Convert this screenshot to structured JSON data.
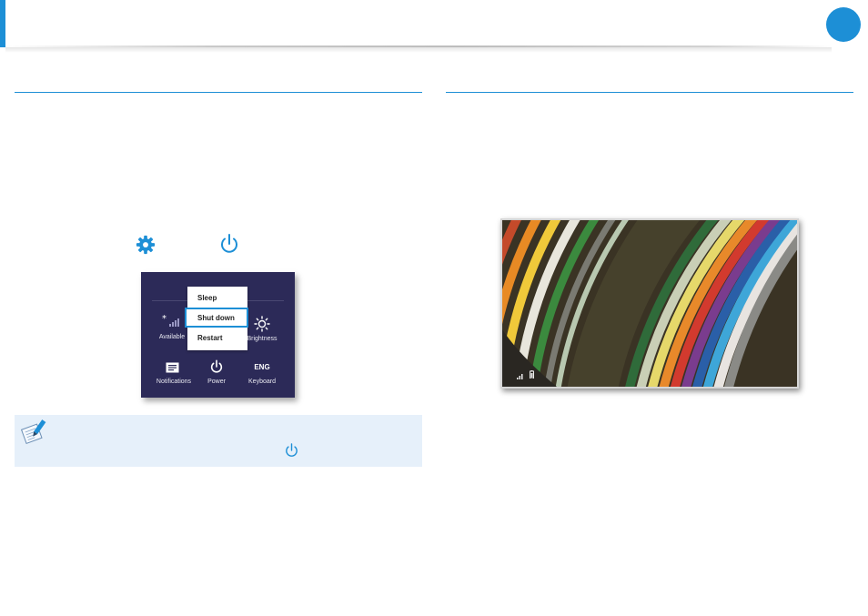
{
  "colors": {
    "accent": "#1d8fd6",
    "panel_bg": "#2c2a58",
    "note_bg": "#e6f0fa"
  },
  "icons": {
    "settings": "gear-icon",
    "power": "power-icon",
    "note": "note-pen-icon",
    "wifi": "wifi-signal-icon",
    "brightness": "brightness-icon",
    "notifications": "notifications-icon",
    "battery": "battery-icon"
  },
  "settings_panel": {
    "tiles": {
      "network_label": "Available",
      "brightness_label": "Brightness",
      "notifications_label": "Notifications",
      "power_label": "Power",
      "keyboard_label": "Keyboard",
      "keyboard_text": "ENG"
    },
    "power_menu": {
      "items": [
        "Sleep",
        "Shut down",
        "Restart"
      ],
      "highlighted": "Shut down"
    }
  }
}
